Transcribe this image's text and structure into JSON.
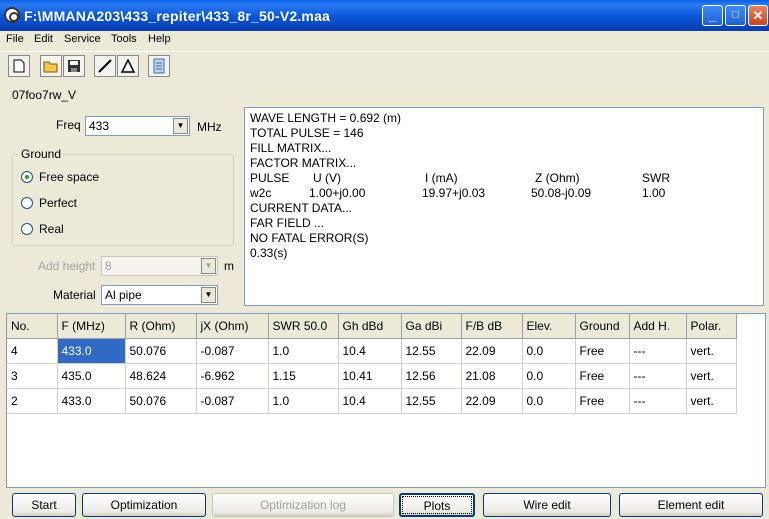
{
  "window": {
    "title": "F:\\MMANA203\\433_repiter\\433_8r_50-V2.maa",
    "minimize": "_",
    "maximize": "□",
    "close": "✕"
  },
  "menu": [
    "File",
    "Edit",
    "Service",
    "Tools",
    "Help"
  ],
  "toolbar_icons": [
    "new-file-icon",
    "open-folder-icon",
    "save-icon",
    "line-icon",
    "triangle-icon",
    "document-stack-icon"
  ],
  "project_name": "07foo7rw_V",
  "freq": {
    "label": "Freq",
    "value": "433",
    "unit": "MHz"
  },
  "ground": {
    "title": "Ground",
    "options": [
      "Free space",
      "Perfect",
      "Real"
    ],
    "selected": "Free space"
  },
  "add_height": {
    "label": "Add height",
    "value": "8",
    "unit": "m"
  },
  "material": {
    "label": "Material",
    "value": "Al pipe"
  },
  "output": {
    "lines_before": [
      "WAVE LENGTH = 0.692 (m)",
      "TOTAL PULSE = 146",
      "FILL MATRIX...",
      "FACTOR MATRIX..."
    ],
    "pulse_header": [
      "PULSE",
      "U (V)",
      "I (mA)",
      "Z (Ohm)",
      "SWR"
    ],
    "pulse_row": [
      "w2c",
      "1.00+j0.00",
      "19.97+j0.03",
      "50.08-j0.09",
      "1.00"
    ],
    "lines_after": [
      "CURRENT DATA...",
      "FAR FIELD ...",
      "NO FATAL ERROR(S)",
      "0.33(s)"
    ]
  },
  "table": {
    "columns": [
      "No.",
      "F (MHz)",
      "R (Ohm)",
      "jX (Ohm)",
      "SWR 50.0",
      "Gh dBd",
      "Ga dBi",
      "F/B dB",
      "Elev.",
      "Ground",
      "Add H.",
      "Polar."
    ],
    "rows": [
      [
        "4",
        "433.0",
        "50.076",
        "-0.087",
        "1.0",
        "10.4",
        "12.55",
        "22.09",
        "0.0",
        "Free",
        "---",
        "vert."
      ],
      [
        "3",
        "435.0",
        "48.624",
        "-6.962",
        "1.15",
        "10.41",
        "12.56",
        "21.08",
        "0.0",
        "Free",
        "---",
        "vert."
      ],
      [
        "2",
        "433.0",
        "50.076",
        "-0.087",
        "1.0",
        "10.4",
        "12.55",
        "22.09",
        "0.0",
        "Free",
        "---",
        "vert."
      ]
    ]
  },
  "buttons": {
    "start": "Start",
    "optimization": "Optimization",
    "optimization_log": "Optimization log",
    "plots": "Plots",
    "wire_edit": "Wire edit",
    "element_edit": "Element edit"
  }
}
